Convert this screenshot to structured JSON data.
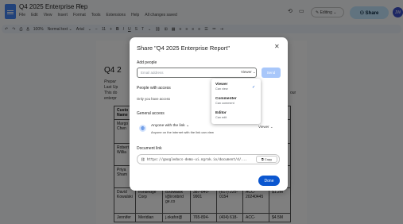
{
  "header": {
    "doc_title": "Q4 2025 Enterprise Rep",
    "star": "☆",
    "menus": [
      "File",
      "Edit",
      "View",
      "Insert",
      "Format",
      "Tools",
      "Extensions",
      "Help",
      "All changes saved"
    ],
    "editing": "✎ Editing ⌄",
    "share": "⚇ Share",
    "avatar": "JW"
  },
  "toolbar": {
    "items": [
      "↶",
      "↷",
      "⎙",
      "A̲",
      "100%",
      "Normal text ⌄",
      "Arial",
      "⌄",
      "−",
      "11",
      "+",
      "B",
      "I",
      "U",
      "S",
      "T",
      "⌄",
      "⛓",
      "⊞",
      "▦",
      "≡",
      "≡",
      "≡",
      "≡",
      "☰",
      "≔",
      "⇥"
    ]
  },
  "doc": {
    "title": "Q4 2",
    "line1": "Prepar",
    "line2": "Last Up",
    "line3": "This do",
    "line4": "enterpr",
    "right1": "our",
    "table": [
      [
        "Custo Name",
        "",
        "",
        "",
        "",
        "",
        "ct"
      ],
      [
        "Margo Chen",
        "",
        "",
        "",
        "",
        "",
        ""
      ],
      [
        "Robert Willia",
        "",
        "",
        "",
        "",
        "",
        ""
      ],
      [
        "Priya Sham",
        "",
        "",
        "",
        "",
        "",
        ""
      ],
      [
        "David Kowalski",
        "Ironbridge Corp",
        "d.kowalsk i@ironbrid ge.co",
        "387-840-9901",
        "(617) 225-0154",
        "ACC-20240445",
        "$1.2M"
      ],
      [
        "Jennifer",
        "Meridian",
        "j.okafor@",
        "765-894-",
        "(404) 618-",
        "ACC-",
        "$4.5M"
      ]
    ]
  },
  "dialog": {
    "title": "Share \"Q4 2025 Enterprise Report\"",
    "close": "✕",
    "add_people": "Add people",
    "email_placeholder": "Email address",
    "role": "Viewer ⌄",
    "send": "Send",
    "people_access": "People with access",
    "only_you": "Only you have access",
    "general_access": "General access",
    "anyone": "Anyone with the link ⌄",
    "anyone_desc": "Anyone on the internet with the link can view",
    "anyone_role": "Viewer ⌄",
    "doc_link": "Document link",
    "link": "https://googledocs-demo-ui.ngrok.io/document/d/...",
    "copy": "⧉ Copy",
    "done": "Done"
  },
  "role_menu": {
    "items": [
      {
        "label": "Viewer",
        "desc": "Can view"
      },
      {
        "label": "Commenter",
        "desc": "Can comment"
      },
      {
        "label": "Editor",
        "desc": "Can edit"
      }
    ],
    "check": "✓"
  }
}
